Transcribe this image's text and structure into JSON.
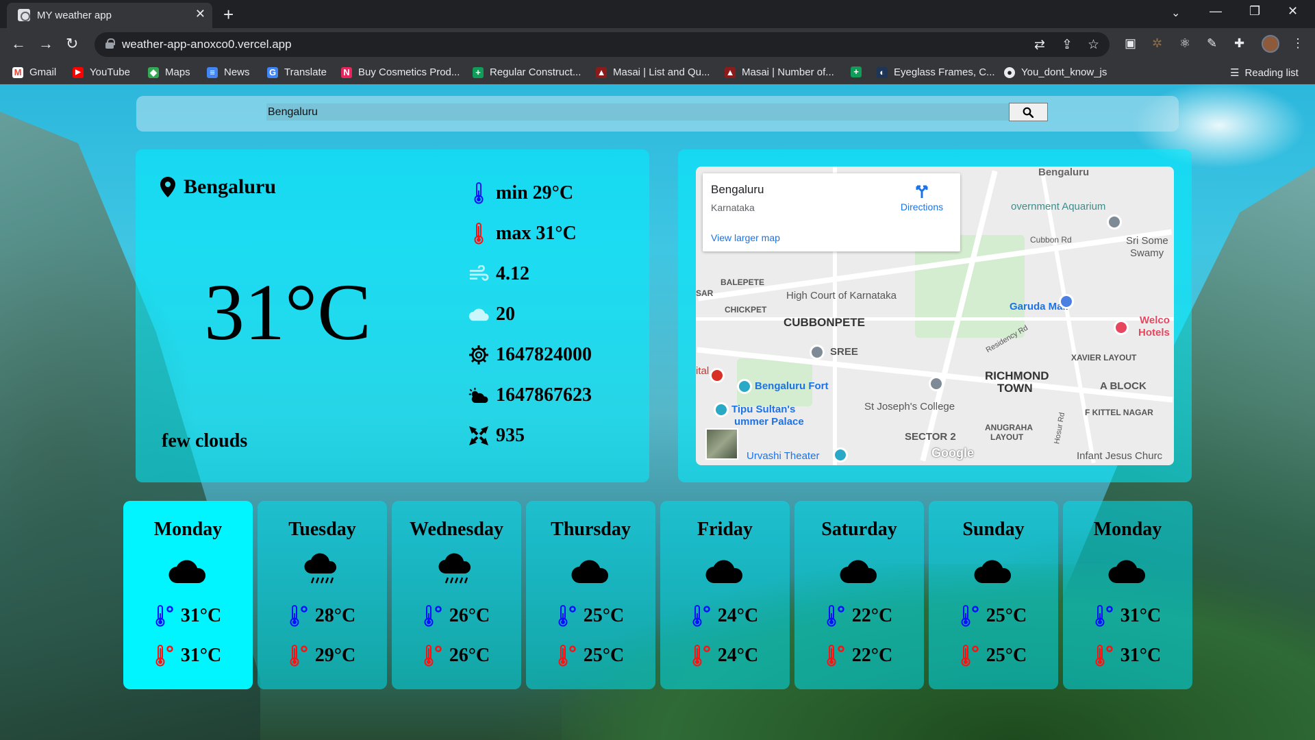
{
  "browser": {
    "tab_title": "MY weather app",
    "url": "weather-app-anoxco0.vercel.app",
    "bookmarks": [
      {
        "label": "Gmail",
        "icon": "gmail-icon"
      },
      {
        "label": "YouTube",
        "icon": "youtube-icon"
      },
      {
        "label": "Maps",
        "icon": "maps-icon"
      },
      {
        "label": "News",
        "icon": "news-icon"
      },
      {
        "label": "Translate",
        "icon": "translate-icon"
      },
      {
        "label": "Buy Cosmetics Prod...",
        "icon": "nykaa-icon"
      },
      {
        "label": "Regular Construct...",
        "icon": "plus-icon"
      },
      {
        "label": "Masai | List and Qu...",
        "icon": "masai-icon"
      },
      {
        "label": "Masai | Number of...",
        "icon": "masai-icon"
      },
      {
        "label": "",
        "icon": "plus-icon"
      },
      {
        "label": "Eyeglass Frames, C...",
        "icon": "lenskart-icon"
      },
      {
        "label": "You_dont_know_js",
        "icon": "github-icon"
      }
    ],
    "reading_list": "Reading list"
  },
  "search": {
    "value": "Bengaluru",
    "button_icon": "search-icon"
  },
  "current": {
    "city": "Bengaluru",
    "temp": "31°C",
    "description": "few clouds",
    "min": "min 29°C",
    "max": "max 31°C",
    "wind": "4.12",
    "clouds": "20",
    "sunrise": "1647824000",
    "sunset": "1647867623",
    "pressure": "935"
  },
  "map": {
    "place_title": "Bengaluru",
    "place_sub": "Karnataka",
    "directions": "Directions",
    "larger_map": "View larger map",
    "labels": {
      "bengaluru": "Bengaluru",
      "aquarium": "overnment Aquarium",
      "cubbon_rd": "Cubbon Rd",
      "sri_some": "Sri Some",
      "swamy": "Swamy",
      "balepete": "BALEPETE",
      "high_court": "High Court of Karnataka",
      "chickpet": "CHICKPET",
      "cubbonpete": "CUBBONPETE",
      "garuda": "Garuda Mall",
      "welco": "Welco",
      "hotels": "Hotels",
      "sree": "SREE",
      "residency": "Residency Rd",
      "xavier": "XAVIER LAYOUT",
      "richmond": "RICHMOND",
      "town": "TOWN",
      "a_block": "A BLOCK",
      "fort": "Bengaluru Fort",
      "tipu": "Tipu Sultan's",
      "summer": "ummer Palace",
      "stjoseph": "St Joseph's College",
      "kittel": "F KITTEL NAGAR",
      "anugraha": "ANUGRAHA",
      "layout": "LAYOUT",
      "sector": "SECTOR 2",
      "urvashi": "Urvashi Theater",
      "infant": "Infant Jesus Churc",
      "hosur": "Hosur Rd",
      "ital": "ital",
      "sar": "SAR",
      "google": "Google"
    }
  },
  "forecast": [
    {
      "day": "Monday",
      "icon": "cloud-icon",
      "min": "31°C",
      "max": "31°C"
    },
    {
      "day": "Tuesday",
      "icon": "rain-cloud-icon",
      "min": "28°C",
      "max": "29°C"
    },
    {
      "day": "Wednesday",
      "icon": "rain-cloud-icon",
      "min": "26°C",
      "max": "26°C"
    },
    {
      "day": "Thursday",
      "icon": "cloud-icon",
      "min": "25°C",
      "max": "25°C"
    },
    {
      "day": "Friday",
      "icon": "cloud-icon",
      "min": "24°C",
      "max": "24°C"
    },
    {
      "day": "Saturday",
      "icon": "cloud-icon",
      "min": "22°C",
      "max": "22°C"
    },
    {
      "day": "Sunday",
      "icon": "cloud-icon",
      "min": "25°C",
      "max": "25°C"
    },
    {
      "day": "Monday",
      "icon": "cloud-icon",
      "min": "31°C",
      "max": "31°C"
    }
  ],
  "colors": {
    "card": "#00eeff",
    "active_day": "#00f5ff",
    "thermo_cold": "#0a10ff",
    "thermo_hot": "#ff1010"
  }
}
